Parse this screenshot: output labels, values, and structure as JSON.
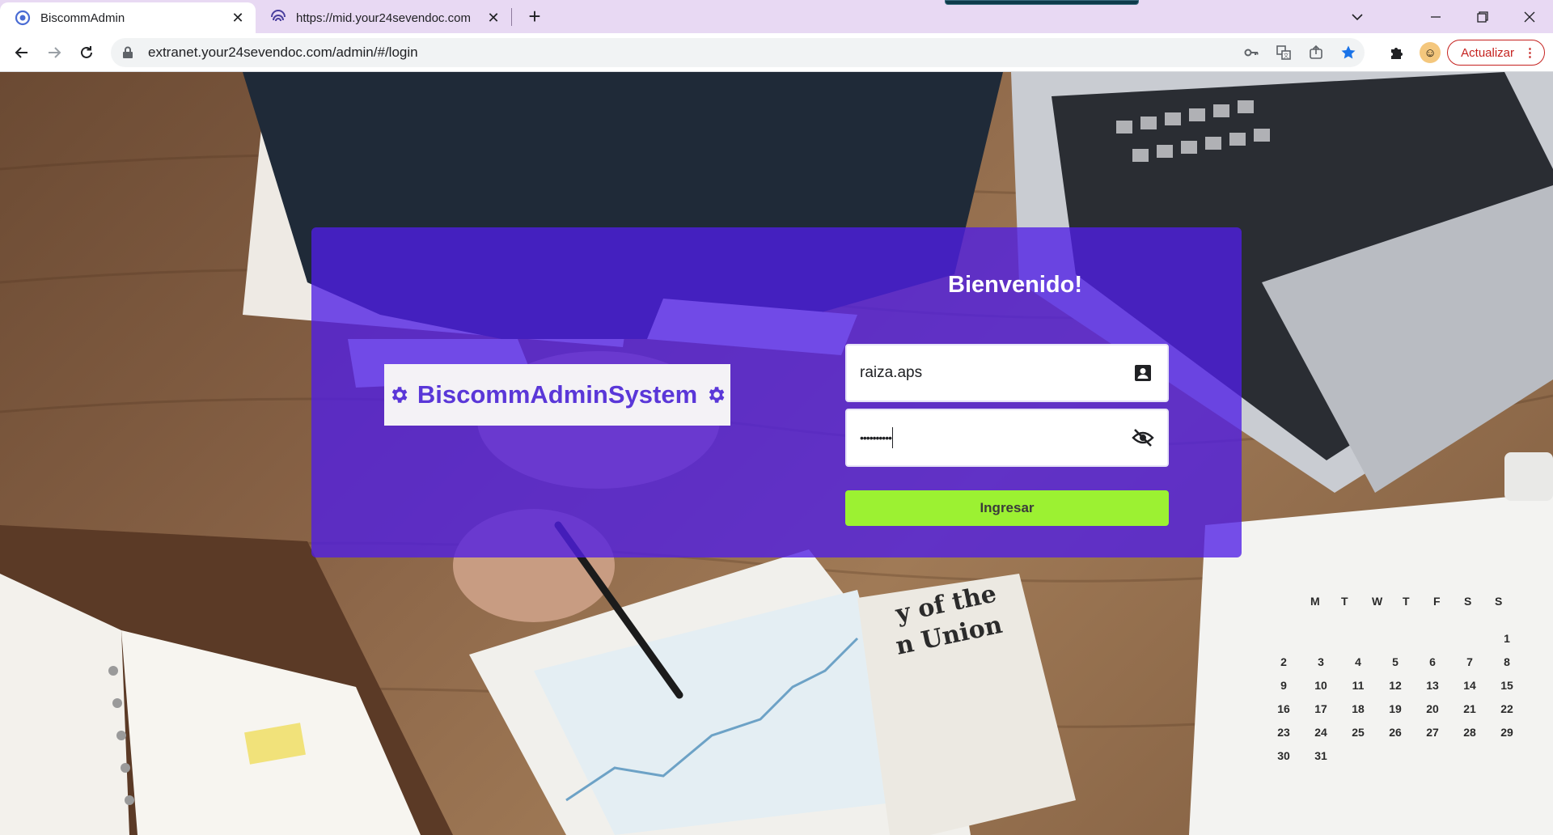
{
  "browser": {
    "tabs": [
      {
        "title": "BiscommAdmin",
        "active": true
      },
      {
        "title": "https://mid.your24sevendoc.com",
        "active": false
      }
    ],
    "new_tab": "+",
    "address": "extranet.your24sevendoc.com/admin/#/login",
    "update_label": "Actualizar",
    "window_controls": [
      "minimize",
      "restore",
      "close"
    ]
  },
  "login": {
    "brand": "BiscommAdminSystem",
    "welcome": "Bienvenido!",
    "username_value": "raiza.aps",
    "password_value": "••••••••••",
    "submit_label": "Ingresar"
  },
  "colors": {
    "card_overlay": "#501ee6",
    "brand_text": "#5a37d8",
    "submit_bg": "#9cf132",
    "tabbar_bg": "#e8d9f3"
  },
  "background_calendar": {
    "days_header": [
      "M",
      "T",
      "W",
      "T",
      "F",
      "S",
      "S"
    ],
    "rows": [
      [
        "",
        "",
        "",
        "",
        "",
        "",
        "1"
      ],
      [
        "2",
        "3",
        "4",
        "5",
        "6",
        "7",
        "8"
      ],
      [
        "9",
        "10",
        "11",
        "12",
        "13",
        "14",
        "15"
      ],
      [
        "16",
        "17",
        "18",
        "19",
        "20",
        "21",
        "22"
      ],
      [
        "23",
        "24",
        "25",
        "26",
        "27",
        "28",
        "29"
      ],
      [
        "30",
        "31",
        "",
        "",
        "",
        "",
        ""
      ]
    ]
  },
  "background_text": {
    "headline_1": "y of the",
    "headline_2": "n Union"
  }
}
